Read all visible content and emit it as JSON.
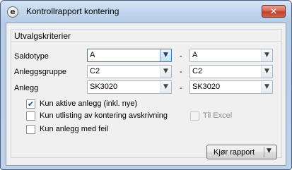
{
  "window": {
    "title": "Kontrollrapport kontering",
    "app_icon": "e",
    "close_glyph": "✕"
  },
  "group": {
    "title": "Utvalgskriterier"
  },
  "filters": {
    "separator": "-",
    "rows": [
      {
        "label": "Saldotype",
        "from": "A",
        "to": "A"
      },
      {
        "label": "Anleggsgruppe",
        "from": "C2",
        "to": "C2"
      },
      {
        "label": "Anlegg",
        "from": "SK3020",
        "to": "SK3020"
      }
    ]
  },
  "checkboxes": {
    "active_assets": {
      "label": "Kun aktive anlegg (inkl. nye)",
      "checked": true
    },
    "depreciation_listing": {
      "label": "Kun utlisting av kontering avskrivning",
      "checked": false
    },
    "to_excel": {
      "label": "Til Excel",
      "checked": false,
      "enabled": false
    },
    "errors_only": {
      "label": "Kun anlegg med feil",
      "checked": false
    }
  },
  "actions": {
    "run_report_label": "Kjør rapport"
  },
  "glyphs": {
    "dropdown_arrow": "▼",
    "check_mark": "✔"
  }
}
